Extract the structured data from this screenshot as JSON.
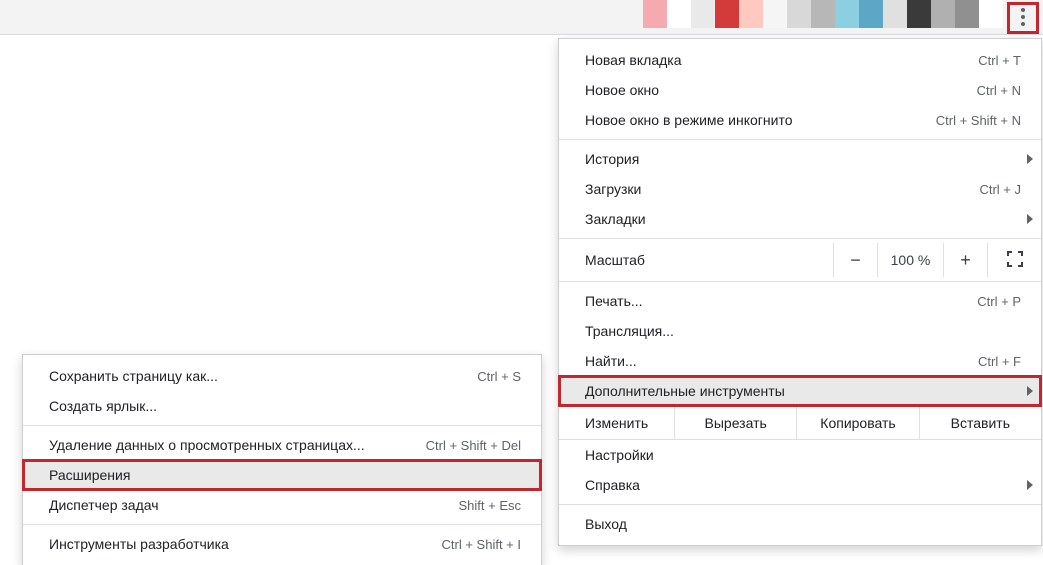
{
  "swatches": [
    "#f4aab0",
    "#ffffff",
    "#e9e9e9",
    "#d33a3a",
    "#ffc9c0",
    "#f5f5f5",
    "#d8d8d8",
    "#b7b7b7",
    "#8ad0e0",
    "#5ea6c6",
    "#e0e0e0",
    "#3a3a3a",
    "#b0b0b0",
    "#909090",
    "#ffffff"
  ],
  "main_menu": {
    "new_tab": {
      "label": "Новая вкладка",
      "shortcut": "Ctrl + T"
    },
    "new_window": {
      "label": "Новое окно",
      "shortcut": "Ctrl + N"
    },
    "incognito": {
      "label": "Новое окно в режиме инкогнито",
      "shortcut": "Ctrl + Shift + N"
    },
    "history": {
      "label": "История"
    },
    "downloads": {
      "label": "Загрузки",
      "shortcut": "Ctrl + J"
    },
    "bookmarks": {
      "label": "Закладки"
    },
    "zoom": {
      "label": "Масштаб",
      "value": "100 %",
      "minus": "−",
      "plus": "+"
    },
    "print": {
      "label": "Печать...",
      "shortcut": "Ctrl + P"
    },
    "cast": {
      "label": "Трансляция..."
    },
    "find": {
      "label": "Найти...",
      "shortcut": "Ctrl + F"
    },
    "more_tools": {
      "label": "Дополнительные инструменты"
    },
    "edit": {
      "label": "Изменить",
      "cut": "Вырезать",
      "copy": "Копировать",
      "paste": "Вставить"
    },
    "settings": {
      "label": "Настройки"
    },
    "help": {
      "label": "Справка"
    },
    "exit": {
      "label": "Выход"
    }
  },
  "sub_menu": {
    "save_page": {
      "label": "Сохранить страницу как...",
      "shortcut": "Ctrl + S"
    },
    "create_shortcut": {
      "label": "Создать ярлык..."
    },
    "clear_data": {
      "label": "Удаление данных о просмотренных страницах...",
      "shortcut": "Ctrl + Shift + Del"
    },
    "extensions": {
      "label": "Расширения"
    },
    "task_manager": {
      "label": "Диспетчер задач",
      "shortcut": "Shift + Esc"
    },
    "dev_tools": {
      "label": "Инструменты разработчика",
      "shortcut": "Ctrl + Shift + I"
    }
  }
}
